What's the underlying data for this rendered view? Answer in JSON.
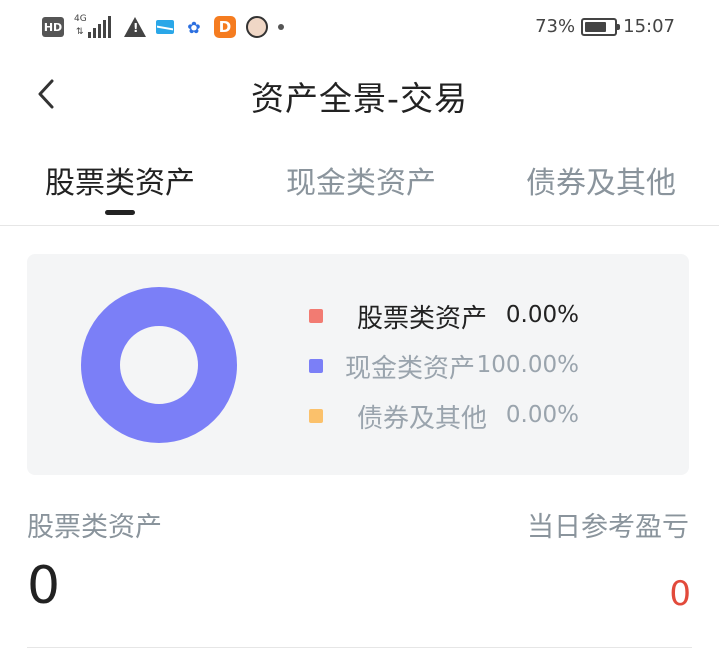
{
  "status_bar": {
    "hd": "HD",
    "network": "4G",
    "battery_pct": "73%",
    "battery_level": 0.73,
    "time": "15:07",
    "icons": [
      "hd-icon",
      "signal-icon",
      "warning-icon",
      "mail-icon",
      "baidu-icon",
      "d-app-icon",
      "avatar-icon",
      "dot-icon"
    ]
  },
  "header": {
    "title": "资产全景-交易",
    "back_icon": "chevron-left-icon"
  },
  "tabs": [
    {
      "label": "股票类资产",
      "active": true
    },
    {
      "label": "现金类资产",
      "active": false
    },
    {
      "label": "债券及其他",
      "active": false
    }
  ],
  "chart_data": {
    "type": "pie",
    "categories": [
      "股票类资产",
      "现金类资产",
      "债券及其他"
    ],
    "values": [
      0.0,
      100.0,
      0.0
    ],
    "value_labels": [
      "0.00%",
      "100.00%",
      "0.00%"
    ],
    "colors": [
      "#f27b72",
      "#7b7ff7",
      "#fbc16b"
    ],
    "legend": "right"
  },
  "legend": [
    {
      "label": "股票类资产",
      "value": "0.00%",
      "color": "#f27b72",
      "text_color": "#222222"
    },
    {
      "label": "现金类资产",
      "value": "100.00%",
      "color": "#7b7ff7",
      "text_color": "#9aa4ad"
    },
    {
      "label": "债券及其他",
      "value": "0.00%",
      "color": "#fbc16b",
      "text_color": "#9aa4ad"
    }
  ],
  "summary": {
    "left_label": "股票类资产",
    "left_value": "0",
    "right_label": "当日参考盈亏",
    "right_value": "0",
    "right_value_color": "#e24a3b"
  }
}
